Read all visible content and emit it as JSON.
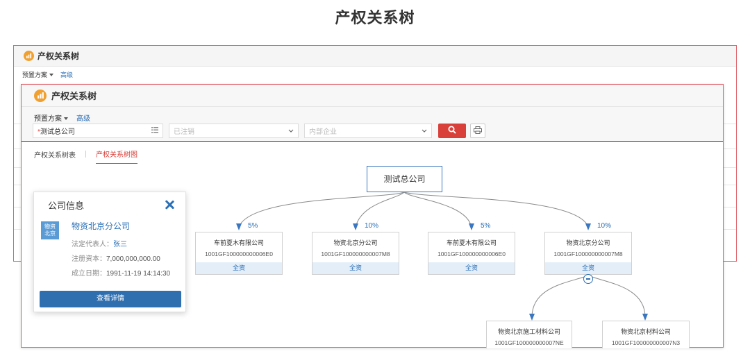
{
  "page_title": "产权关系树",
  "background_window": {
    "title": "产权关系树",
    "preset": "预置方案",
    "advanced": "高级"
  },
  "window": {
    "title": "产权关系树",
    "preset": "预置方案",
    "advanced": "高级",
    "company_field": {
      "required_mark": "*",
      "value": "测试总公司"
    },
    "status_field": {
      "placeholder": "已注销"
    },
    "type_field": {
      "placeholder": "内部企业"
    },
    "tabs": [
      {
        "label": "产权关系树表",
        "active": false
      },
      {
        "label": "产权关系树图",
        "active": true
      }
    ]
  },
  "tree": {
    "root": "测试总公司",
    "children": [
      {
        "percent": "5%",
        "name": "车前夏木有限公司",
        "code": "1001GF100000000006E0",
        "footer": "全资"
      },
      {
        "percent": "10%",
        "name": "物资北京分公司",
        "code": "1001GF100000000007M8",
        "footer": "全资"
      },
      {
        "percent": "5%",
        "name": "车前夏木有限公司",
        "code": "1001GF100000000006E0",
        "footer": "全资"
      },
      {
        "percent": "10%",
        "name": "物资北京分公司",
        "code": "1001GF100000000007M8",
        "footer": "全资"
      }
    ],
    "grandchildren": [
      {
        "name": "物资北京施工材料公司",
        "code": "1001GF100000000007NE"
      },
      {
        "name": "物资北京材料公司",
        "code": "1001GF100000000007N3"
      }
    ]
  },
  "popup": {
    "title": "公司信息",
    "badge_line1": "物资",
    "badge_line2": "北京",
    "company_name": "物资北京分公司",
    "legal_rep_label": "法定代表人：",
    "legal_rep_value": "张三",
    "capital_label": "注册资本：",
    "capital_value": "7,000,000,000.00",
    "date_label": "成立日期：",
    "date_value": "1991-11-19 14:14:30",
    "detail_button": "查看详情"
  },
  "colors": {
    "accent_blue": "#2a6fb5",
    "accent_red": "#d9403a",
    "icon_orange": "#f0a030"
  }
}
